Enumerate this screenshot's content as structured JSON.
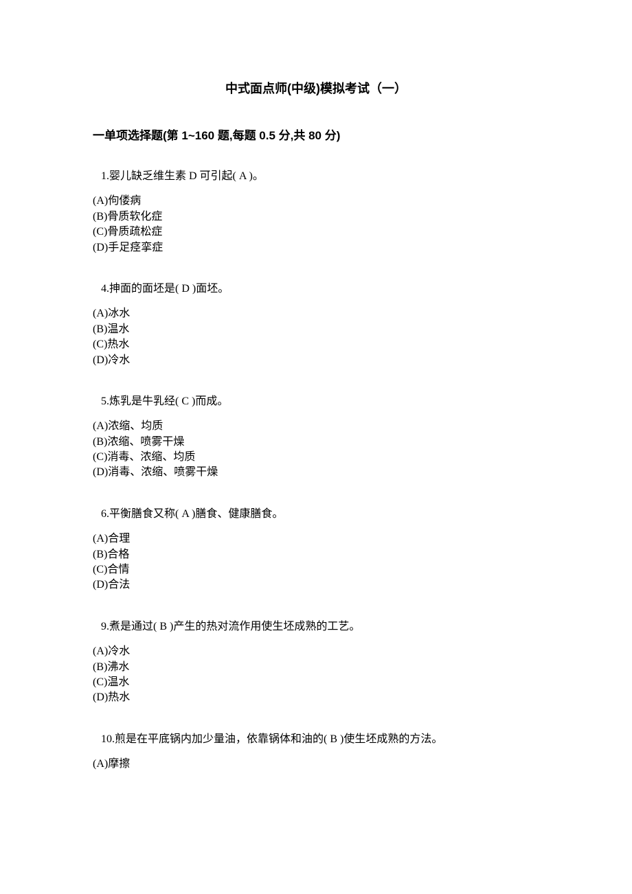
{
  "title": "中式面点师(中级)模拟考试（一）",
  "section_heading": "一单项选择题(第 1~160 题,每题 0.5 分,共 80 分)",
  "questions": [
    {
      "text": "1.婴儿缺乏维生素 D 可引起(  A   )。",
      "options": [
        "(A)佝偻病",
        "(B)骨质软化症",
        "(C)骨质疏松症",
        "(D)手足痉挛症"
      ]
    },
    {
      "text": "4.抻面的面坯是(  D    )面坯。",
      "options": [
        "(A)冰水",
        "(B)温水",
        "(C)热水",
        "(D)冷水"
      ]
    },
    {
      "text": "5.炼乳是牛乳经(  C    )而成。",
      "options": [
        "(A)浓缩、均质",
        "(B)浓缩、喷雾干燥",
        "(C)消毒、浓缩、均质",
        "(D)消毒、浓缩、喷雾干燥"
      ]
    },
    {
      "text": "6.平衡膳食又称(    A  )膳食、健康膳食。",
      "options": [
        "(A)合理",
        "(B)合格",
        "(C)合情",
        "(D)合法"
      ]
    },
    {
      "text": "9.煮是通过(  B    )产生的热对流作用使生坯成熟的工艺。",
      "options": [
        "(A)冷水",
        "(B)沸水",
        "(C)温水",
        "(D)热水"
      ]
    },
    {
      "text": "10.煎是在平底锅内加少量油，依靠锅体和油的(  B    )使生坯成熟的方法。",
      "options": [
        "(A)摩擦"
      ]
    }
  ]
}
